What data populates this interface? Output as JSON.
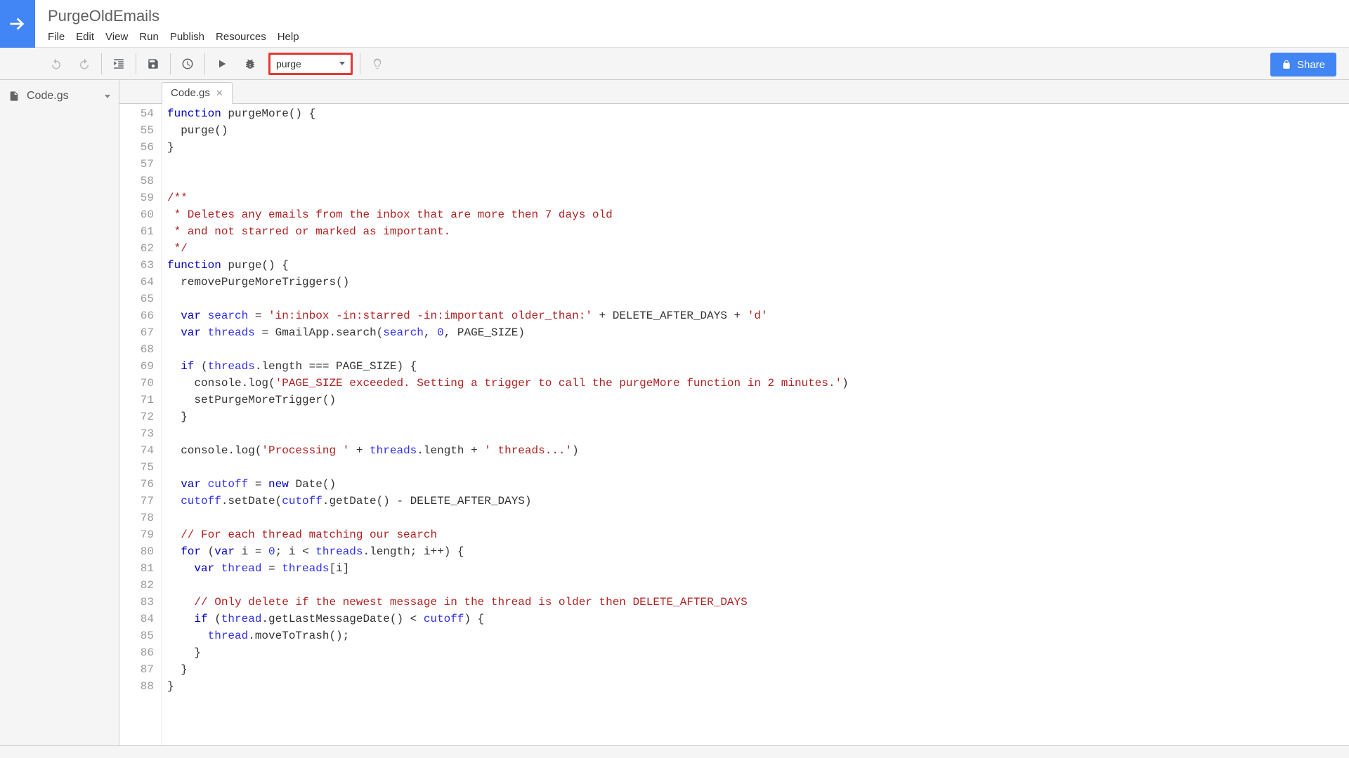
{
  "project": {
    "title": "PurgeOldEmails"
  },
  "menu": {
    "file": "File",
    "edit": "Edit",
    "view": "View",
    "run": "Run",
    "publish": "Publish",
    "resources": "Resources",
    "help": "Help"
  },
  "toolbar": {
    "function_selected": "purge",
    "share_label": "Share"
  },
  "sidebar": {
    "file_name": "Code.gs"
  },
  "tabs": {
    "active": "Code.gs"
  },
  "editor": {
    "first_line_number": 54,
    "lines": [
      {
        "n": 54,
        "tokens": [
          [
            "kw",
            "function"
          ],
          [
            "pl",
            " purgeMore() {"
          ]
        ]
      },
      {
        "n": 55,
        "tokens": [
          [
            "pl",
            "  purge()"
          ]
        ]
      },
      {
        "n": 56,
        "tokens": [
          [
            "pl",
            "}"
          ]
        ]
      },
      {
        "n": 57,
        "tokens": []
      },
      {
        "n": 58,
        "tokens": []
      },
      {
        "n": 59,
        "tokens": [
          [
            "doc",
            "/**"
          ]
        ]
      },
      {
        "n": 60,
        "tokens": [
          [
            "doc",
            " * Deletes any emails from the inbox that are more then 7 days old"
          ]
        ]
      },
      {
        "n": 61,
        "tokens": [
          [
            "doc",
            " * and not starred or marked as important."
          ]
        ]
      },
      {
        "n": 62,
        "tokens": [
          [
            "doc",
            " */"
          ]
        ]
      },
      {
        "n": 63,
        "tokens": [
          [
            "kw",
            "function"
          ],
          [
            "pl",
            " purge() {"
          ]
        ]
      },
      {
        "n": 64,
        "tokens": [
          [
            "pl",
            "  removePurgeMoreTriggers()"
          ]
        ]
      },
      {
        "n": 65,
        "tokens": []
      },
      {
        "n": 66,
        "tokens": [
          [
            "pl",
            "  "
          ],
          [
            "kw",
            "var"
          ],
          [
            "pl",
            " "
          ],
          [
            "var",
            "search"
          ],
          [
            "pl",
            " = "
          ],
          [
            "str",
            "'in:inbox -in:starred -in:important older_than:'"
          ],
          [
            "pl",
            " + DELETE_AFTER_DAYS + "
          ],
          [
            "str",
            "'d'"
          ]
        ]
      },
      {
        "n": 67,
        "tokens": [
          [
            "pl",
            "  "
          ],
          [
            "kw",
            "var"
          ],
          [
            "pl",
            " "
          ],
          [
            "var",
            "threads"
          ],
          [
            "pl",
            " = GmailApp.search("
          ],
          [
            "var",
            "search"
          ],
          [
            "pl",
            ", "
          ],
          [
            "num",
            "0"
          ],
          [
            "pl",
            ", PAGE_SIZE)"
          ]
        ]
      },
      {
        "n": 68,
        "tokens": []
      },
      {
        "n": 69,
        "tokens": [
          [
            "pl",
            "  "
          ],
          [
            "kw",
            "if"
          ],
          [
            "pl",
            " ("
          ],
          [
            "var",
            "threads"
          ],
          [
            "pl",
            ".length === PAGE_SIZE) {"
          ]
        ]
      },
      {
        "n": 70,
        "tokens": [
          [
            "pl",
            "    console.log("
          ],
          [
            "str",
            "'PAGE_SIZE exceeded. Setting a trigger to call the purgeMore function in 2 minutes.'"
          ],
          [
            "pl",
            ")"
          ]
        ]
      },
      {
        "n": 71,
        "tokens": [
          [
            "pl",
            "    setPurgeMoreTrigger()"
          ]
        ]
      },
      {
        "n": 72,
        "tokens": [
          [
            "pl",
            "  }"
          ]
        ]
      },
      {
        "n": 73,
        "tokens": []
      },
      {
        "n": 74,
        "tokens": [
          [
            "pl",
            "  console.log("
          ],
          [
            "str",
            "'Processing '"
          ],
          [
            "pl",
            " + "
          ],
          [
            "var",
            "threads"
          ],
          [
            "pl",
            ".length + "
          ],
          [
            "str",
            "' threads...'"
          ],
          [
            "pl",
            ")"
          ]
        ]
      },
      {
        "n": 75,
        "tokens": []
      },
      {
        "n": 76,
        "tokens": [
          [
            "pl",
            "  "
          ],
          [
            "kw",
            "var"
          ],
          [
            "pl",
            " "
          ],
          [
            "var",
            "cutoff"
          ],
          [
            "pl",
            " = "
          ],
          [
            "kw",
            "new"
          ],
          [
            "pl",
            " Date()"
          ]
        ]
      },
      {
        "n": 77,
        "tokens": [
          [
            "pl",
            "  "
          ],
          [
            "var",
            "cutoff"
          ],
          [
            "pl",
            ".setDate("
          ],
          [
            "var",
            "cutoff"
          ],
          [
            "pl",
            ".getDate() - DELETE_AFTER_DAYS)"
          ]
        ]
      },
      {
        "n": 78,
        "tokens": []
      },
      {
        "n": 79,
        "tokens": [
          [
            "pl",
            "  "
          ],
          [
            "com",
            "// For each thread matching our search"
          ]
        ]
      },
      {
        "n": 80,
        "tokens": [
          [
            "pl",
            "  "
          ],
          [
            "kw",
            "for"
          ],
          [
            "pl",
            " ("
          ],
          [
            "kw",
            "var"
          ],
          [
            "pl",
            " i = "
          ],
          [
            "num",
            "0"
          ],
          [
            "pl",
            "; i < "
          ],
          [
            "var",
            "threads"
          ],
          [
            "pl",
            ".length; i++) {"
          ]
        ]
      },
      {
        "n": 81,
        "tokens": [
          [
            "pl",
            "    "
          ],
          [
            "kw",
            "var"
          ],
          [
            "pl",
            " "
          ],
          [
            "var",
            "thread"
          ],
          [
            "pl",
            " = "
          ],
          [
            "var",
            "threads"
          ],
          [
            "pl",
            "[i]"
          ]
        ]
      },
      {
        "n": 82,
        "tokens": []
      },
      {
        "n": 83,
        "tokens": [
          [
            "pl",
            "    "
          ],
          [
            "com",
            "// Only delete if the newest message in the thread is older then DELETE_AFTER_DAYS"
          ]
        ]
      },
      {
        "n": 84,
        "tokens": [
          [
            "pl",
            "    "
          ],
          [
            "kw",
            "if"
          ],
          [
            "pl",
            " ("
          ],
          [
            "var",
            "thread"
          ],
          [
            "pl",
            ".getLastMessageDate() < "
          ],
          [
            "var",
            "cutoff"
          ],
          [
            "pl",
            ") {"
          ]
        ]
      },
      {
        "n": 85,
        "tokens": [
          [
            "pl",
            "      "
          ],
          [
            "var",
            "thread"
          ],
          [
            "pl",
            ".moveToTrash();"
          ]
        ]
      },
      {
        "n": 86,
        "tokens": [
          [
            "pl",
            "    }"
          ]
        ]
      },
      {
        "n": 87,
        "tokens": [
          [
            "pl",
            "  }"
          ]
        ]
      },
      {
        "n": 88,
        "tokens": [
          [
            "pl",
            "}"
          ]
        ]
      }
    ]
  }
}
